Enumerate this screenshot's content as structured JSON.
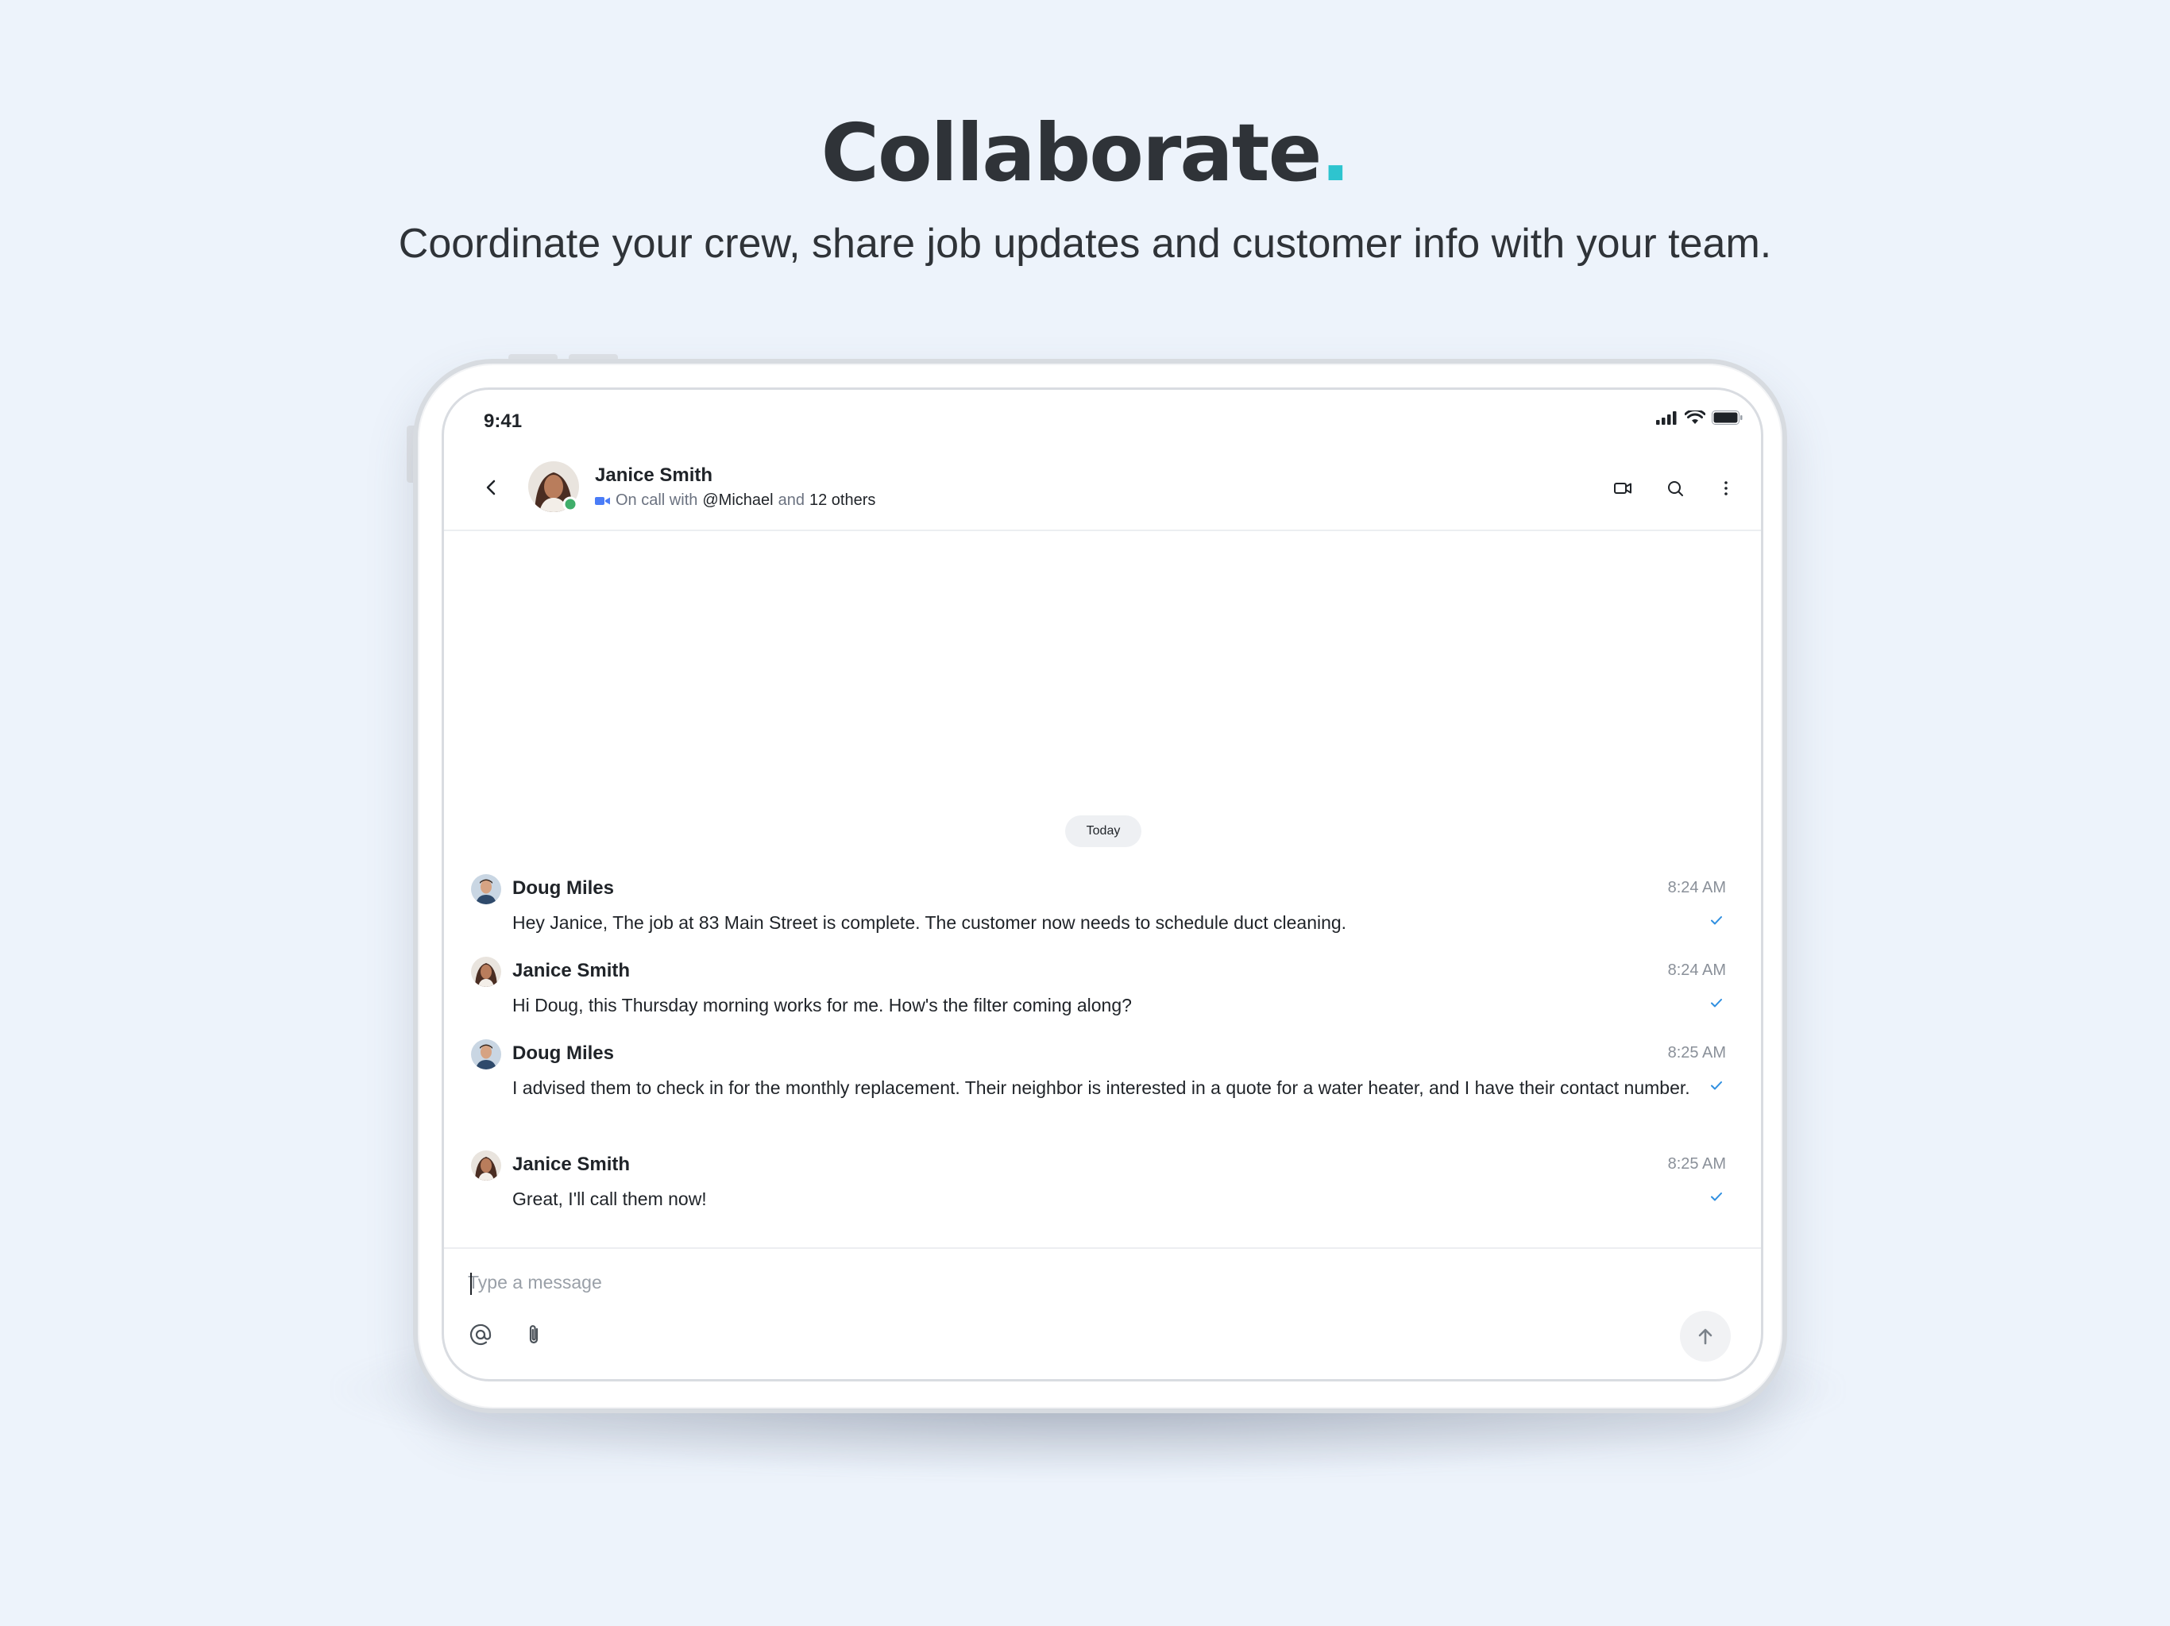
{
  "hero": {
    "title": "Collaborate",
    "title_dot": ".",
    "subtitle": "Coordinate your crew, share job updates and customer info with your team."
  },
  "colors": {
    "accent_dot": "#2ec4cf",
    "online": "#3fae6a",
    "check": "#2f8fe0",
    "call_icon": "#4a7cf7"
  },
  "status_bar": {
    "time": "9:41",
    "icons": [
      "signal-icon",
      "wifi-icon",
      "battery-icon"
    ]
  },
  "chat_header": {
    "name": "Janice Smith",
    "status_prefix": "On call with",
    "mention": "@Michael",
    "joiner": "and",
    "others": "12 others",
    "icons": [
      "back-icon",
      "video-call-icon",
      "search-icon",
      "more-vertical-icon"
    ]
  },
  "date_divider": "Today",
  "messages": [
    {
      "sender": "Doug Miles",
      "time": "8:24 AM",
      "text": "Hey Janice, The job at 83 Main Street is complete. The customer now needs to schedule duct cleaning.",
      "status": "sent"
    },
    {
      "sender": "Janice Smith",
      "time": "8:24 AM",
      "text": "Hi Doug, this Thursday morning works for me. How's the filter coming along?",
      "status": "sent"
    },
    {
      "sender": "Doug Miles",
      "time": "8:25 AM",
      "text": "I advised them to check in for the monthly replacement. Their neighbor is interested in a quote for a water heater, and I have their contact number.",
      "status": "sent"
    },
    {
      "sender": "Janice Smith",
      "time": "8:25 AM",
      "text": "Great, I'll call them now!",
      "status": "sent"
    }
  ],
  "composer": {
    "value": "",
    "placeholder": "Type a message",
    "icons": [
      "mention-icon",
      "attachment-icon",
      "send-arrow-icon"
    ]
  }
}
